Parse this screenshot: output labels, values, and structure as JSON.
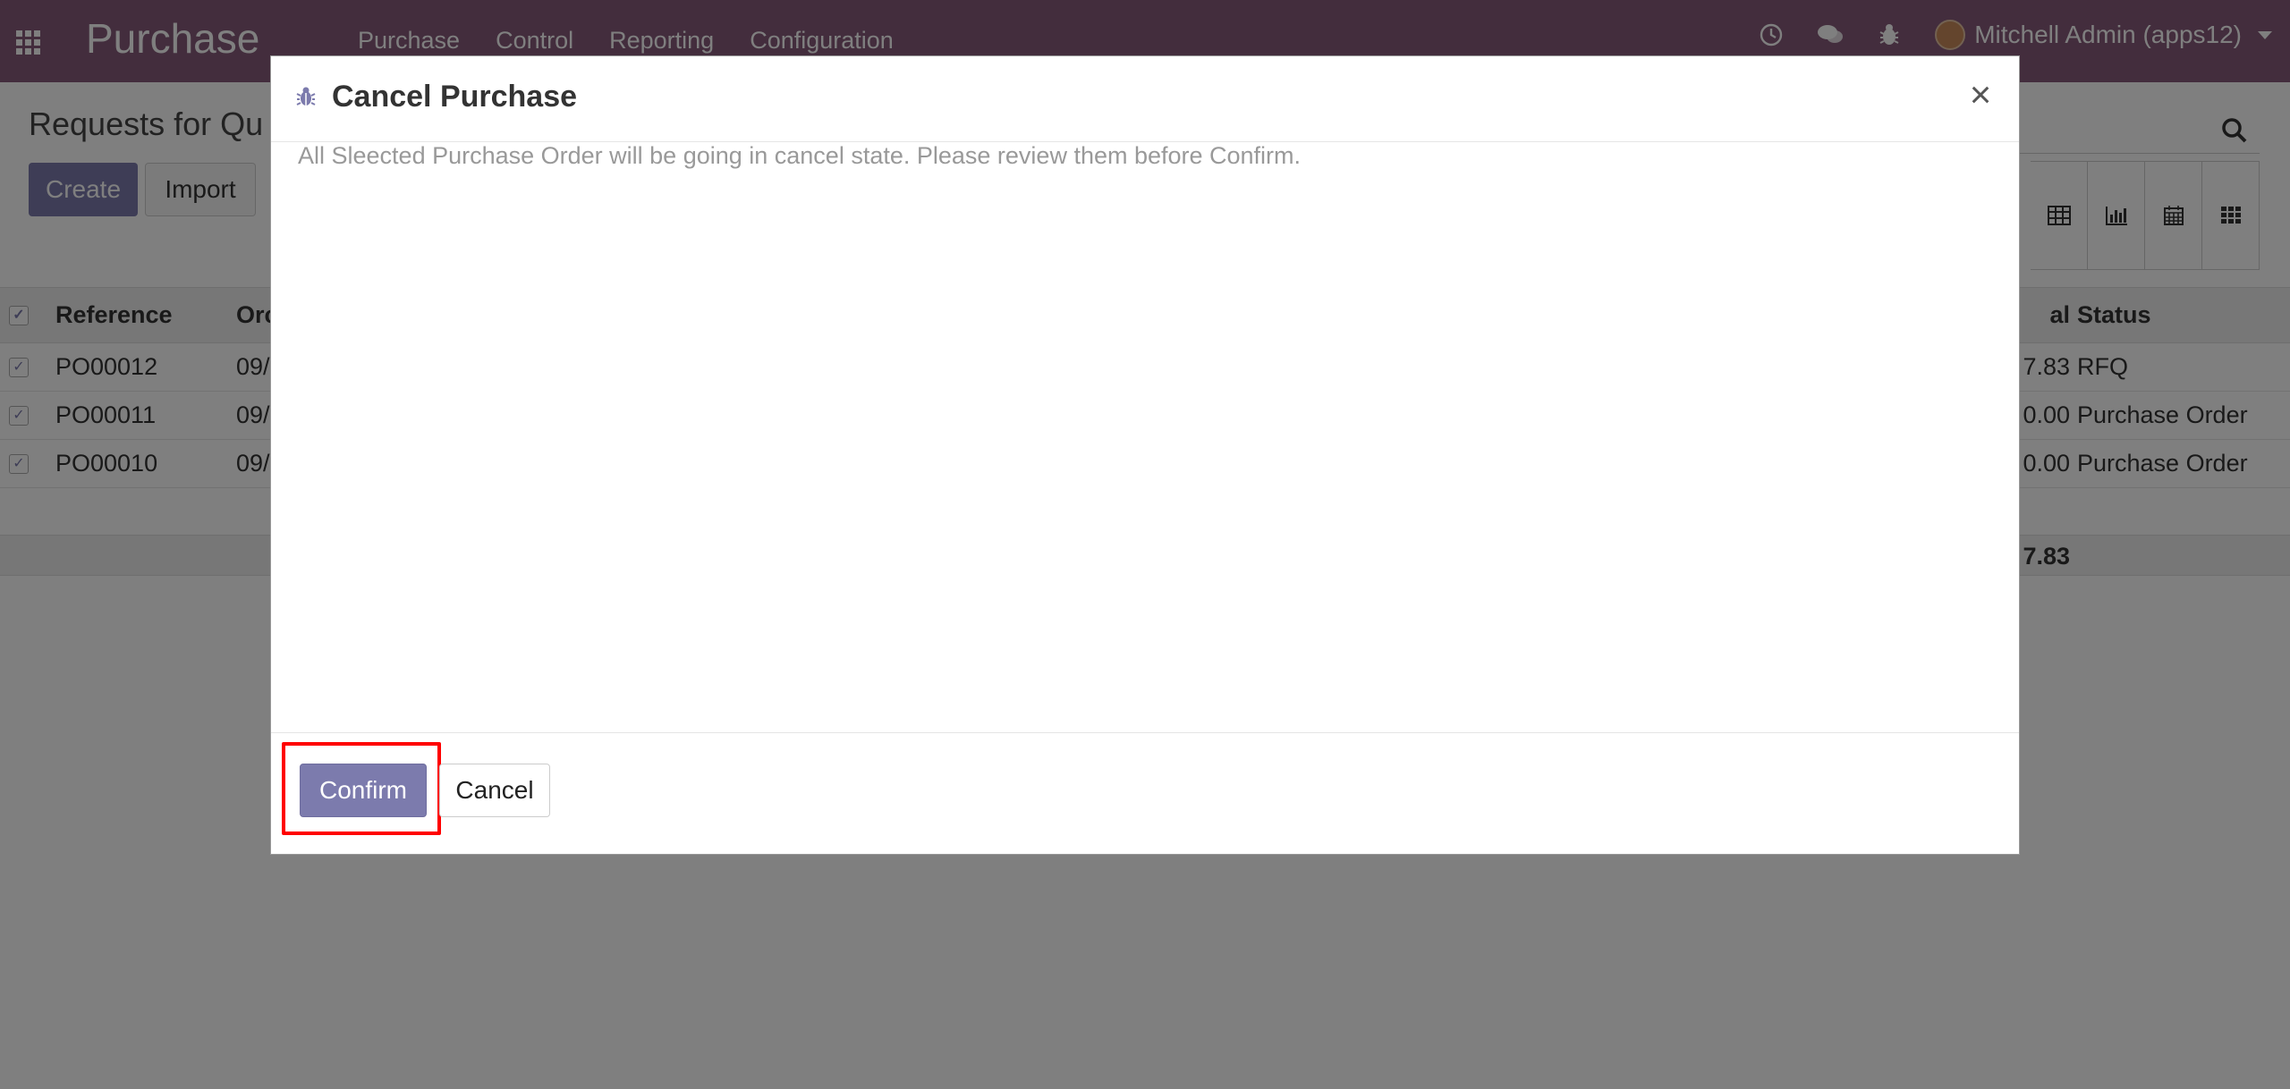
{
  "navbar": {
    "app_name": "Purchase",
    "menu": [
      "Purchase",
      "Control",
      "Reporting",
      "Configuration"
    ],
    "user_name": "Mitchell Admin (apps12)",
    "color": "#875a7b"
  },
  "control_panel": {
    "title": "Requests for Qu",
    "create_label": "Create",
    "import_label": "Import"
  },
  "list": {
    "headers": {
      "reference": "Reference",
      "date": "Orc",
      "total": "al",
      "status": "Status"
    },
    "rows": [
      {
        "reference": "PO00012",
        "date": "09/",
        "total": "7.83",
        "status": "RFQ"
      },
      {
        "reference": "PO00011",
        "date": "09/",
        "total": "0.00",
        "status": "Purchase Order"
      },
      {
        "reference": "PO00010",
        "date": "09/",
        "total": "0.00",
        "status": "Purchase Order"
      }
    ],
    "footer_total": "7.83"
  },
  "modal": {
    "title": "Cancel Purchase",
    "message": "All Sleected Purchase Order will be going in cancel state. Please review them before Confirm.",
    "confirm_label": "Confirm",
    "cancel_label": "Cancel",
    "close_glyph": "×",
    "highlight_color": "#ff0000"
  }
}
